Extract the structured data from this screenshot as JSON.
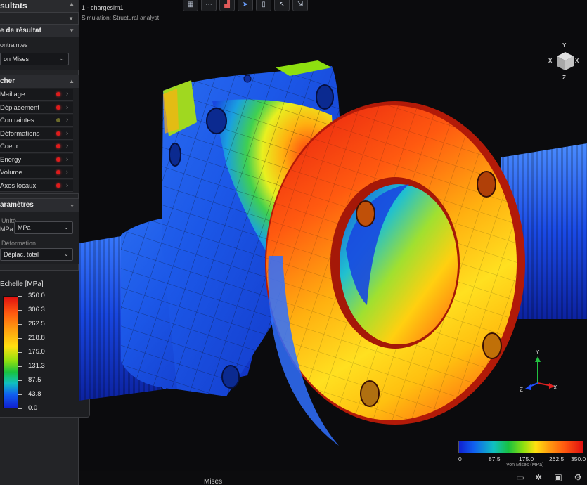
{
  "panel": {
    "title": "sultats",
    "result_type_label": "e de résultat",
    "contraintes_label": "ontraintes",
    "vonmises_value": "on Mises",
    "afficher_head": "cher",
    "items": [
      {
        "label": "Maillage",
        "dot": "red"
      },
      {
        "label": "Déplacement",
        "dot": "red"
      },
      {
        "label": "Contraintes",
        "dot": "dim"
      },
      {
        "label": "Déformations",
        "dot": "red"
      },
      {
        "label": "Coeur",
        "dot": "red"
      },
      {
        "label": "Energy",
        "dot": "red"
      },
      {
        "label": "Volume",
        "dot": "red"
      },
      {
        "label": "Axes locaux",
        "dot": "red"
      }
    ],
    "params_head": "aramètres",
    "unite_label": "Unité",
    "mpa_short": "MPa",
    "mpa_value": "MPa",
    "deformation_label": "Déformation",
    "deformation_value": "Déplac. total",
    "scale_title": "Echelle [MPa]",
    "scale_values": [
      "350.0",
      "306.3",
      "262.5",
      "218.8",
      "175.0",
      "131.3",
      "87.5",
      "43.8",
      "0.0"
    ]
  },
  "document": {
    "title": "1 - chargesim1",
    "subtitle": "Simulation: Structural analyst"
  },
  "toolbar": {
    "icons": [
      "grid-icon",
      "dots-icon",
      "chart-icon",
      "cursor-icon",
      "book-icon",
      "arrow-icon",
      "export-icon"
    ]
  },
  "view_cube": {
    "x": "X",
    "y": "Y",
    "z": "Z",
    "x2": "X"
  },
  "triad": {
    "y": "Y",
    "x": "X",
    "z": "Z"
  },
  "legend": {
    "values": [
      "0",
      "87.5",
      "175.0",
      "262.5",
      "350.0"
    ],
    "caption": "Von Mises (MPa)"
  },
  "bottom": {
    "partial_text": "Mises"
  },
  "colors": {
    "red": "#e01010",
    "orange": "#ff7a10",
    "yellow": "#ffe010",
    "green": "#18c040",
    "cyan": "#10c0c0",
    "blue": "#1040e0",
    "panel_bg": "#232427"
  }
}
